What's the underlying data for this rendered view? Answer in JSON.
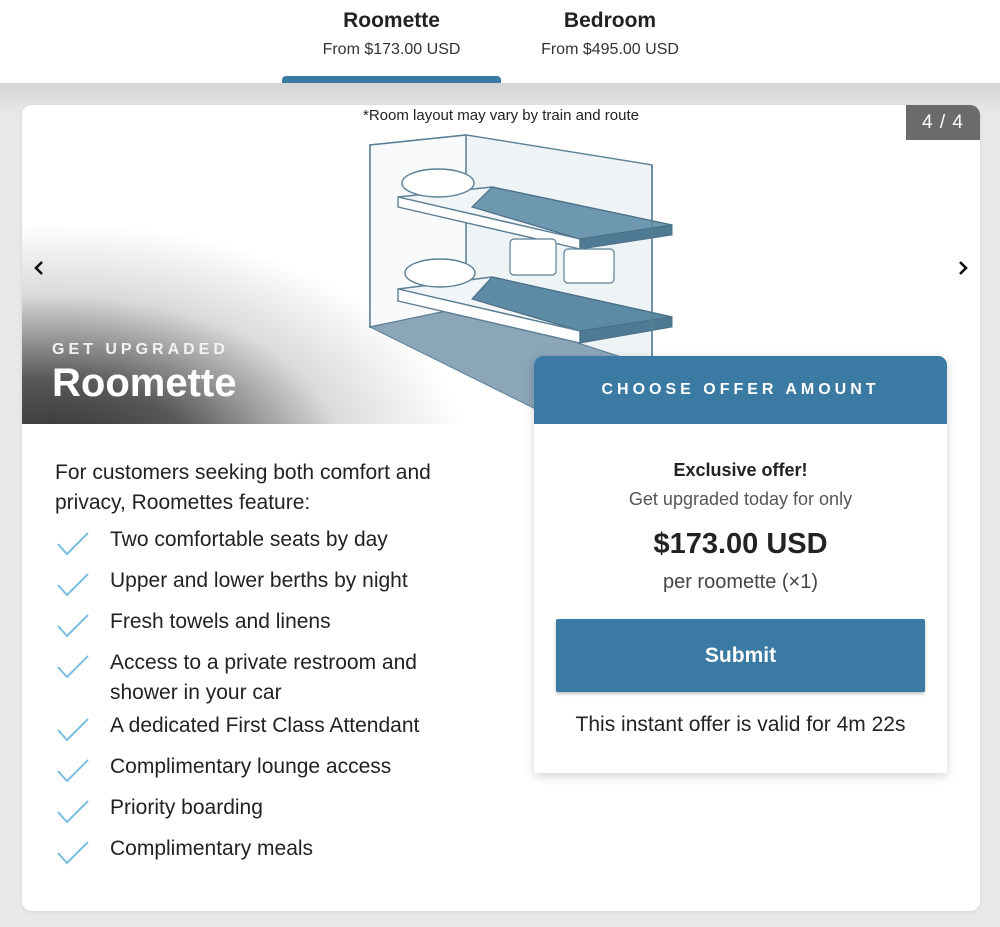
{
  "tabs": [
    {
      "name": "Roomette",
      "price": "From $173.00 USD",
      "active": true
    },
    {
      "name": "Bedroom",
      "price": "From $495.00 USD",
      "active": false
    }
  ],
  "hero": {
    "note": "*Room layout may vary by train and route",
    "counter": "4 / 4",
    "eyebrow": "GET UPGRADED",
    "title": "Roomette",
    "prev_icon": "chevron-left-icon",
    "next_icon": "chevron-right-icon"
  },
  "details": {
    "intro": "For customers seeking both comfort and privacy, Roomettes feature:",
    "features": [
      "Two comfortable seats by day",
      "Upper and lower berths by night",
      "Fresh towels and linens",
      "Access to a private restroom and shower in your car",
      "A dedicated First Class Attendant",
      "Complimentary lounge access",
      "Priority boarding",
      "Complimentary meals"
    ],
    "check_icon": "checkmark-icon"
  },
  "offer": {
    "header": "CHOOSE OFFER AMOUNT",
    "exclusive": "Exclusive offer!",
    "subtitle": "Get upgraded today for only",
    "price": "$173.00 USD",
    "per": "per roomette (×1)",
    "submit_label": "Submit",
    "timer": "This instant offer is valid for 4m 22s"
  },
  "colors": {
    "accent": "#3b7ba3",
    "check": "#7bbfe0",
    "counter_bg": "#6b6b6b"
  }
}
